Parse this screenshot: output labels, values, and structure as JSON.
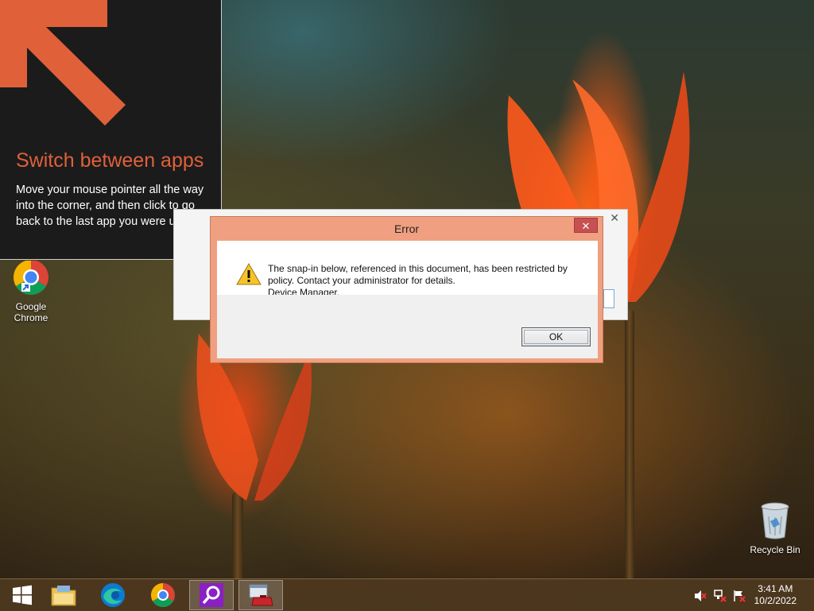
{
  "tip": {
    "title": "Switch between apps",
    "body": "Move your mouse pointer all the way into the corner, and then click to go back to the last app you were using."
  },
  "desktop": {
    "chrome_label": "Google Chrome",
    "recycle_label": "Recycle Bin"
  },
  "dialog": {
    "title": "Error",
    "close_symbol": "✕",
    "message_line1": "The snap-in below, referenced in this document, has been restricted by policy. Contact your administrator for details.",
    "message_line2": "Device Manager.",
    "ok_label": "OK"
  },
  "background_window": {
    "close_symbol": "✕"
  },
  "taskbar": {
    "items": [
      "start-button",
      "file-explorer",
      "microsoft-edge",
      "google-chrome",
      "search-app",
      "device-manager-app"
    ],
    "clock_time": "3:41 AM",
    "clock_date": "10/2/2022"
  },
  "colors": {
    "tip_accent": "#e0603a",
    "dialog_frame": "#f0a080",
    "close_button": "#c75050"
  }
}
